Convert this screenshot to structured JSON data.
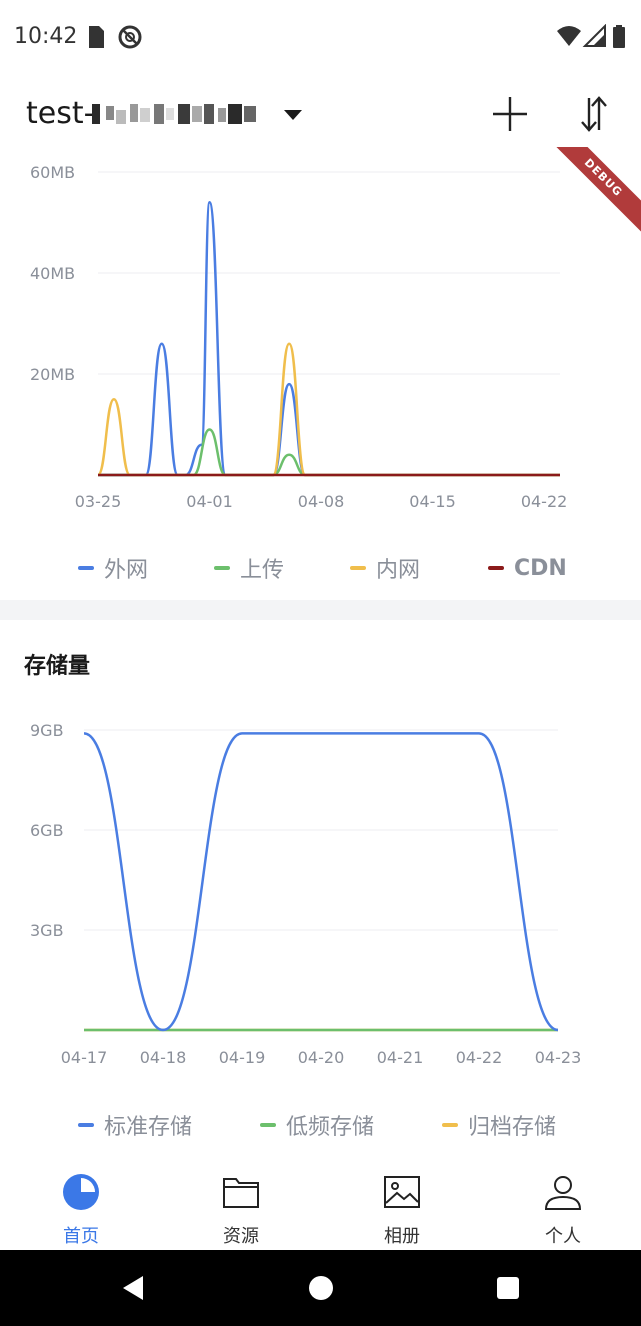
{
  "status_bar": {
    "time": "10:42",
    "left_icons": [
      "sd-card-icon",
      "no-disturb-icon"
    ],
    "right_icons": [
      "wifi-icon",
      "signal-icon",
      "battery-icon"
    ]
  },
  "app_bar": {
    "bucket_name": "test-",
    "bucket_name_redacted": true,
    "actions": [
      "add-icon",
      "sort-icon"
    ]
  },
  "debug_banner": "DEBUG",
  "traffic": {
    "legend": [
      {
        "name": "外网",
        "color": "#4a7de2"
      },
      {
        "name": "上传",
        "color": "#6cbf6c"
      },
      {
        "name": "内网",
        "color": "#f0be4c"
      },
      {
        "name": "CDN",
        "color": "#8b1a1a"
      }
    ]
  },
  "storage": {
    "title": "存储量",
    "legend": [
      {
        "name": "标准存储",
        "color": "#4a7de2"
      },
      {
        "name": "低频存储",
        "color": "#6cbf6c"
      },
      {
        "name": "归档存储",
        "color": "#f0be4c"
      }
    ]
  },
  "chart_data": [
    {
      "type": "line",
      "title": "",
      "xlabel": "",
      "ylabel": "",
      "x_ticks": [
        "03-25",
        "04-01",
        "04-08",
        "04-15",
        "04-22"
      ],
      "y_ticks": [
        "60MB",
        "40MB",
        "20MB"
      ],
      "ylim": [
        0,
        60
      ],
      "y_unit": "MB",
      "x_range_days": [
        0,
        29
      ],
      "grid": true,
      "legend_position": "bottom",
      "series": [
        {
          "name": "外网",
          "color": "#4a7de2",
          "peaks": [
            {
              "day": 4,
              "value": 26
            },
            {
              "day": 6.5,
              "value": 6
            },
            {
              "day": 7,
              "value": 54
            },
            {
              "day": 12,
              "value": 18
            }
          ]
        },
        {
          "name": "上传",
          "color": "#6cbf6c",
          "peaks": [
            {
              "day": 7,
              "value": 9
            },
            {
              "day": 12,
              "value": 4
            }
          ]
        },
        {
          "name": "内网",
          "color": "#f0be4c",
          "peaks": [
            {
              "day": 1,
              "value": 15
            },
            {
              "day": 12,
              "value": 26
            }
          ]
        },
        {
          "name": "CDN",
          "color": "#8b1a1a",
          "peaks": []
        }
      ]
    },
    {
      "type": "line",
      "title": "存储量",
      "xlabel": "",
      "ylabel": "",
      "x": [
        "04-17",
        "04-18",
        "04-19",
        "04-20",
        "04-21",
        "04-22",
        "04-23"
      ],
      "y_ticks": [
        "9GB",
        "6GB",
        "3GB"
      ],
      "ylim": [
        0,
        9
      ],
      "y_unit": "GB",
      "grid": true,
      "legend_position": "bottom",
      "series": [
        {
          "name": "标准存储",
          "color": "#4a7de2",
          "values": [
            8.9,
            0,
            8.9,
            8.9,
            8.9,
            8.9,
            0
          ]
        },
        {
          "name": "低频存储",
          "color": "#6cbf6c",
          "values": [
            0,
            0,
            0,
            0,
            0,
            0,
            0
          ]
        },
        {
          "name": "归档存储",
          "color": "#f0be4c",
          "values": [
            0,
            0,
            0,
            0,
            0,
            0,
            0
          ]
        }
      ]
    }
  ],
  "bottom_nav": [
    {
      "label": "首页",
      "icon": "pie-chart-icon",
      "active": true
    },
    {
      "label": "资源",
      "icon": "folder-icon",
      "active": false
    },
    {
      "label": "相册",
      "icon": "image-icon",
      "active": false
    },
    {
      "label": "个人",
      "icon": "person-icon",
      "active": false
    }
  ],
  "system_nav": [
    "back-icon",
    "home-icon",
    "recents-icon"
  ]
}
